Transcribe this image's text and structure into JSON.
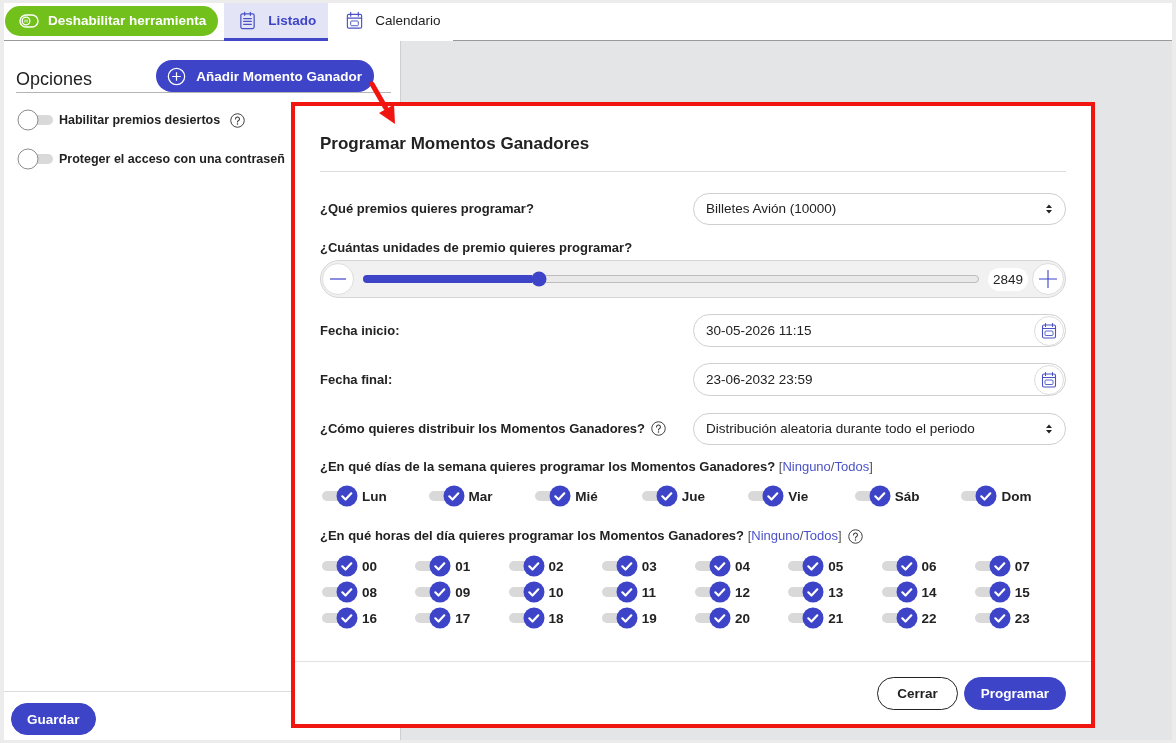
{
  "top_bar": {
    "tool_button": "Deshabilitar herramienta",
    "tabs": [
      {
        "label": "Listado",
        "kind": "list",
        "selected": true
      },
      {
        "label": "Calendario",
        "kind": "calendar",
        "selected": false
      }
    ]
  },
  "options_panel": {
    "title": "Opciones",
    "add_button": "Añadir Momento Ganador",
    "options": [
      {
        "label": "Habilitar premios desiertos",
        "on": false,
        "help": true
      },
      {
        "label": "Proteger el acceso con una contraseñ",
        "on": false
      }
    ],
    "save_button": "Guardar"
  },
  "dialog": {
    "title": "Programar Momentos Ganadores",
    "fields": [
      {
        "kind": "select",
        "label": "¿Qué premios quieres programar?",
        "value": "Billetes Avión (10000)"
      },
      {
        "kind": "slider",
        "label": "¿Cuántas unidades de premio quieres programar?",
        "level": 0.285,
        "reading": "2849"
      },
      {
        "kind": "date",
        "label": "Fecha inicio:",
        "value": "30-05-2026 11:15"
      },
      {
        "kind": "date",
        "label": "Fecha final:",
        "value": "23-06-2032 23:59"
      },
      {
        "kind": "select",
        "label": "¿Cómo quieres distribuir los Momentos Ganadores?",
        "help": true,
        "value": "Distribución aleatoria durante todo el periodo"
      }
    ],
    "days": {
      "question": "¿En qué días de la semana quieres programar los Momentos Ganadores?",
      "bracket_open": "[",
      "links": [
        "Ninguno",
        "Todos"
      ],
      "link_separator": "/",
      "bracket_close": "]",
      "items": [
        {
          "label": "Lun",
          "on": true
        },
        {
          "label": "Mar",
          "on": true
        },
        {
          "label": "Mié",
          "on": true
        },
        {
          "label": "Jue",
          "on": true
        },
        {
          "label": "Vie",
          "on": true
        },
        {
          "label": "Sáb",
          "on": true
        },
        {
          "label": "Dom",
          "on": true
        }
      ]
    },
    "hours": {
      "question": "¿En qué horas del día quieres programar los Momentos Ganadores?",
      "bracket_open": "[",
      "links": [
        "Ninguno",
        "Todos"
      ],
      "link_separator": "/",
      "bracket_close": "]",
      "help": true,
      "items": [
        {
          "label": "00",
          "on": true
        },
        {
          "label": "01",
          "on": true
        },
        {
          "label": "02",
          "on": true
        },
        {
          "label": "03",
          "on": true
        },
        {
          "label": "04",
          "on": true
        },
        {
          "label": "05",
          "on": true
        },
        {
          "label": "06",
          "on": true
        },
        {
          "label": "07",
          "on": true
        },
        {
          "label": "08",
          "on": true
        },
        {
          "label": "09",
          "on": true
        },
        {
          "label": "10",
          "on": true
        },
        {
          "label": "11",
          "on": true
        },
        {
          "label": "12",
          "on": true
        },
        {
          "label": "13",
          "on": true
        },
        {
          "label": "14",
          "on": true
        },
        {
          "label": "15",
          "on": true
        },
        {
          "label": "16",
          "on": true
        },
        {
          "label": "17",
          "on": true
        },
        {
          "label": "18",
          "on": true
        },
        {
          "label": "19",
          "on": true
        },
        {
          "label": "20",
          "on": true
        },
        {
          "label": "21",
          "on": true
        },
        {
          "label": "22",
          "on": true
        },
        {
          "label": "23",
          "on": true
        }
      ]
    },
    "buttons": [
      {
        "label": "Cerrar",
        "kind": "secondary"
      },
      {
        "label": "Programar",
        "kind": "primary"
      }
    ]
  }
}
